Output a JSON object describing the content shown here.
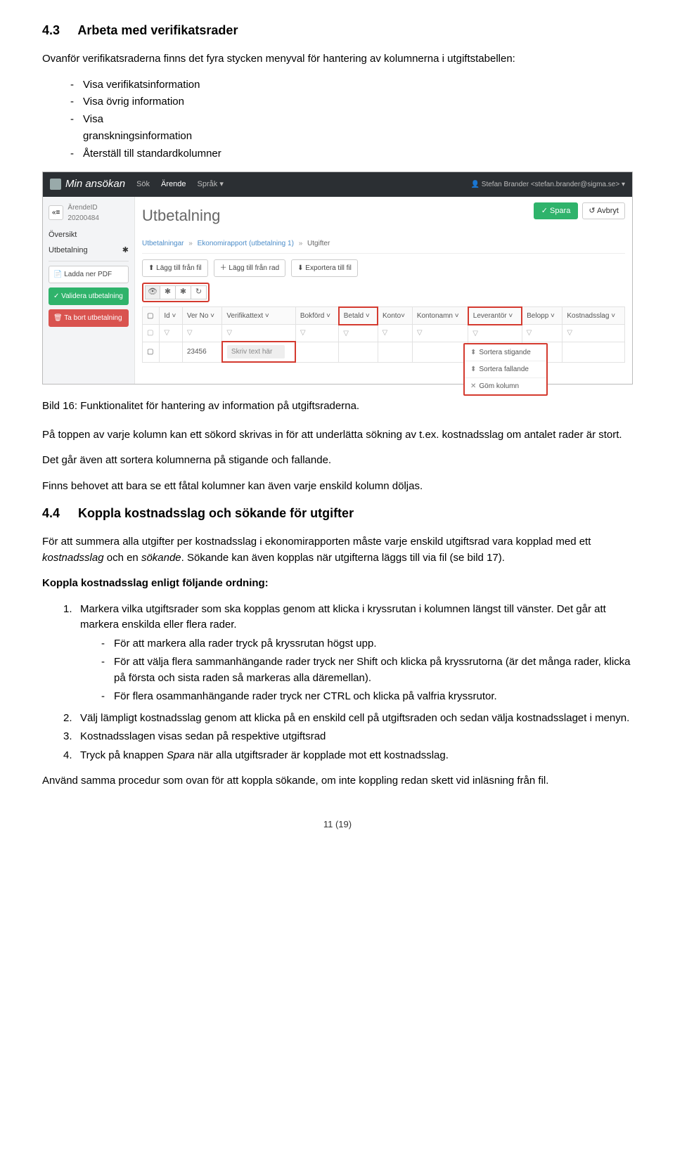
{
  "section43": {
    "num": "4.3",
    "title": "Arbeta med verifikatsrader",
    "intro": "Ovanför verifikatsraderna finns det fyra stycken menyval för hantering av kolumnerna i utgiftstabellen:",
    "options": [
      "Visa verifikatsinformation",
      "Visa övrig information",
      "Visa",
      "granskningsinformation",
      "Återställ till standardkolumner"
    ]
  },
  "shot": {
    "brand": "Min ansökan",
    "menu_sok": "Sök",
    "menu_arende": "Ärende",
    "menu_sprak": "Språk",
    "user": "Stefan Brander <stefan.brander@sigma.se>",
    "idbtn": "«≡",
    "idtext": "ÄrendeID 20200484",
    "left_oversikt": "Översikt",
    "left_utbet": "Utbetalning",
    "left_star": "✱",
    "btn_pdf": "📄 Ladda ner PDF",
    "btn_validera": "✓ Validera utbetalning",
    "btn_tabort": "🗑 Ta bort utbetalning",
    "btn_save": "✓ Spara",
    "btn_avbryt": "↺ Avbryt",
    "main_h": "Utbetalning",
    "crumb1": "Utbetalningar",
    "crumb2": "Ekonomirapport (utbetalning 1)",
    "crumb3": "Utgifter",
    "tb_fromfile": "⬆ Lägg till från fil",
    "tb_fromrow": "＋ Lägg till från rad",
    "tb_export": "⬇ Exportera till fil",
    "colbtn_eye": "👁",
    "colbtn_star1": "✱",
    "colbtn_star2": "✱",
    "colbtn_reset": "↻",
    "th": {
      "id": "Id",
      "verno": "Ver No",
      "vtext": "Verifikattext",
      "bokford": "Bokförd",
      "betald": "Betald",
      "konto": "Konto",
      "kontonamn": "Kontonamn",
      "lev": "Leverantör",
      "belopp": "Belopp",
      "kslag": "Kostnadsslag"
    },
    "row_verno": "23456",
    "row_placeholder": "Skriv text här",
    "pop1": "Sortera stigande",
    "pop2": "Sortera fallande",
    "pop3": "Göm kolumn"
  },
  "caption": "Bild 16: Funktionalitet för hantering av information på utgiftsraderna.",
  "para_top": "På toppen av varje kolumn kan ett sökord skrivas in för att underlätta sökning av t.ex. kostnadsslag om antalet rader är stort.",
  "para_sort": "Det går även att sortera kolumnerna på stigande och fallande.",
  "para_hide": "Finns behovet att bara se ett fåtal kolumner kan även varje enskild kolumn döljas.",
  "section44": {
    "num": "4.4",
    "title": "Koppla kostnadsslag och sökande för utgifter",
    "p1_a": "För att summera alla utgifter per kostnadsslag i ekonomirapporten måste varje enskild utgiftsrad vara kopplad med ett ",
    "p1_k": "kostnadsslag",
    "p1_b": " och en ",
    "p1_s": "sökande",
    "p1_c": ". Sökande kan även kopplas när utgifterna läggs till via fil (se bild 17).",
    "p2": "Koppla kostnadsslag enligt följande ordning:",
    "li1": "Markera vilka utgiftsrader som ska kopplas genom att klicka i kryssrutan i kolumnen längst till vänster. Det går att markera enskilda eller flera rader.",
    "li1a": "För att markera alla rader tryck på kryssrutan högst upp.",
    "li1b": "För att välja flera sammanhängande rader tryck ner Shift och klicka på kryssrutorna (är det många rader, klicka på första och sista raden så markeras alla däremellan).",
    "li1c": "För flera osammanhängande rader tryck ner CTRL och klicka på valfria kryssrutor.",
    "li2": "Välj lämpligt kostnadsslag genom att klicka på en enskild cell på utgiftsraden och sedan välja kostnadsslaget i menyn.",
    "li3": "Kostnadsslagen visas sedan på respektive utgiftsrad",
    "li4_a": "Tryck på knappen ",
    "li4_b": "Spara",
    "li4_c": " när alla utgiftsrader är kopplade mot ett kostnadsslag.",
    "p3": "Använd samma procedur som ovan för att koppla sökande, om inte koppling redan skett vid inläsning från fil."
  },
  "footer": "11 (19)"
}
